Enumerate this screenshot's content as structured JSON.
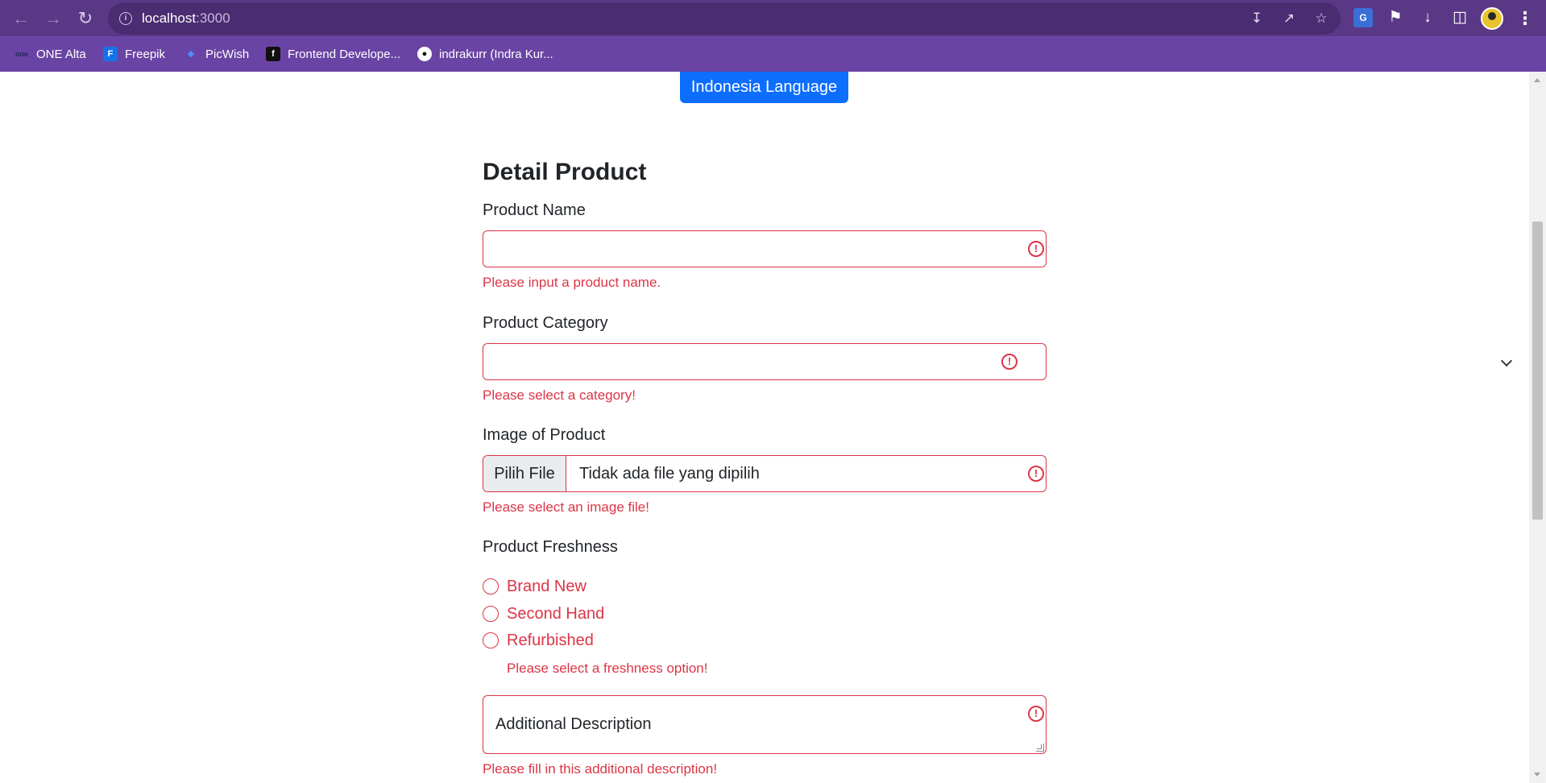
{
  "browser": {
    "url_host": "localhost",
    "url_port": ":3000",
    "bookmarks": [
      {
        "label": "ONE Alta",
        "icon": "one-alta-icon"
      },
      {
        "label": "Freepik",
        "icon": "freepik-icon"
      },
      {
        "label": "PicWish",
        "icon": "picwish-icon"
      },
      {
        "label": "Frontend Develope...",
        "icon": "frontend-icon"
      },
      {
        "label": "indrakurr (Indra Kur...",
        "icon": "github-icon"
      }
    ]
  },
  "page": {
    "lang_button": "Indonesia Language",
    "title": "Detail Product",
    "product_name": {
      "label": "Product Name",
      "value": "",
      "error": "Please input a product name."
    },
    "product_category": {
      "label": "Product Category",
      "selected": "",
      "error": "Please select a category!"
    },
    "image": {
      "label": "Image of Product",
      "button": "Pilih File",
      "status": "Tidak ada file yang dipilih",
      "error": "Please select an image file!"
    },
    "freshness": {
      "label": "Product Freshness",
      "options": [
        "Brand New",
        "Second Hand",
        "Refurbished"
      ],
      "error": "Please select a freshness option!"
    },
    "description": {
      "placeholder": "Additional Description",
      "error": "Please fill in this additional description!"
    }
  },
  "colors": {
    "accent": "#0d6efd",
    "error": "#dc3545",
    "chrome": "#5a3886",
    "bookmarks_bar": "#6a44a4"
  }
}
